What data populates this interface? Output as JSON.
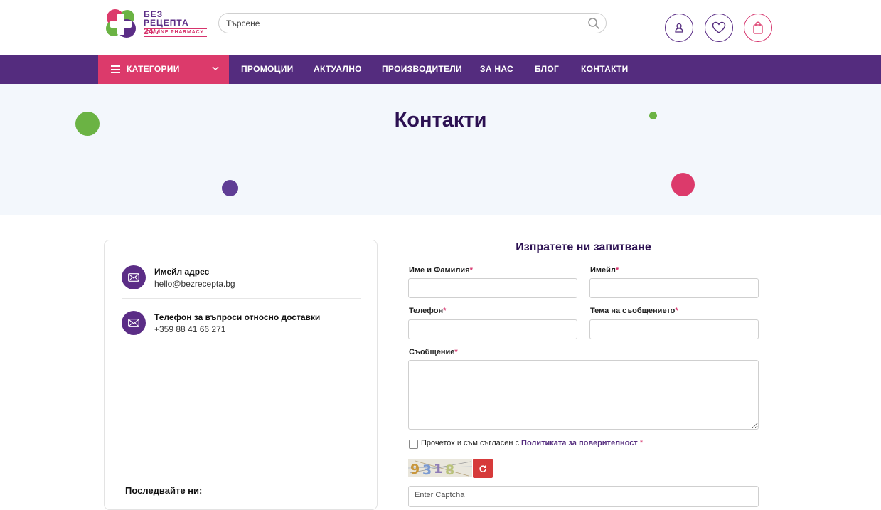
{
  "header": {
    "logo": {
      "line1": "БЕЗ",
      "line2": "РЕЦЕПТА",
      "line2_hours": "24/7",
      "subtitle": "ONLINE PHARMACY"
    },
    "search": {
      "placeholder": "Търсене"
    },
    "icons": [
      "user-icon",
      "heart-icon",
      "cart-icon"
    ]
  },
  "nav": {
    "categories_label": "КАТЕГОРИИ",
    "items": [
      "ПРОМОЦИИ",
      "АКТУАЛНО",
      "ПРОИЗВОДИТЕЛИ",
      "ЗА НАС",
      "БЛОГ",
      "КОНТАКТИ"
    ]
  },
  "hero": {
    "title": "Контакти"
  },
  "contact_info": {
    "email": {
      "title": "Имейл адрес",
      "value": "hello@bezrecepta.bg",
      "icon": "envelope-icon"
    },
    "phone": {
      "title": "Телефон за въпроси относно доставки",
      "value": "+359 88 41 66 271",
      "icon": "envelope-icon"
    },
    "follow_label": "Последвайте ни:"
  },
  "form": {
    "title": "Изпратете ни запитване",
    "name_label": "Име и Фамилия",
    "email_label": "Имейл",
    "phone_label": "Телефон",
    "subject_label": "Тема на съобщението",
    "message_label": "Съобщение",
    "required_mark": "*",
    "consent_text": "Прочетох и съм съгласен с",
    "consent_link": "Политиката за поверителност",
    "captcha_text": "9318",
    "captcha_placeholder": "Enter Captcha"
  },
  "colors": {
    "primary": "#542c7e",
    "accent": "#dc3a6b",
    "green": "#6bb344",
    "hero_bg": "#f3f7fc"
  }
}
